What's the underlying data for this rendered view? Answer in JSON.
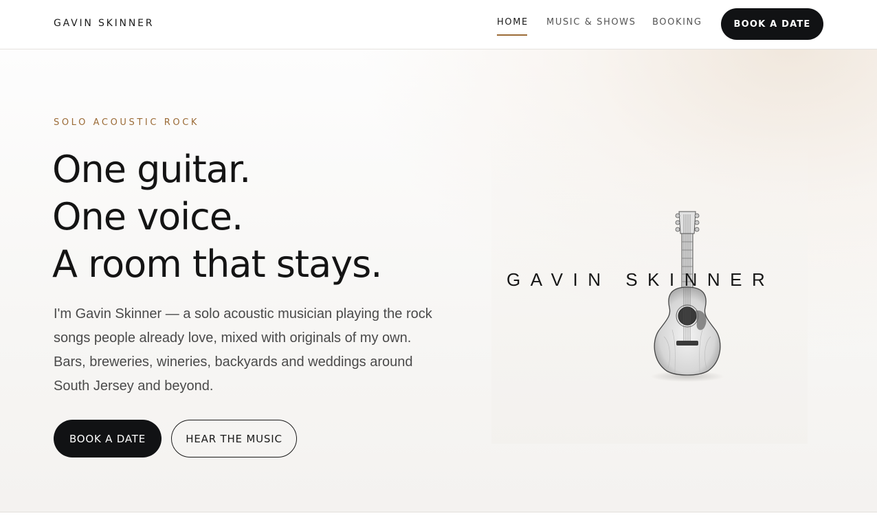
{
  "header": {
    "brand": "GAVIN SKINNER",
    "nav": {
      "home": "HOME",
      "music_shows": "MUSIC & SHOWS",
      "booking": "BOOKING",
      "cta": "BOOK A DATE"
    },
    "active_item": "HOME"
  },
  "hero": {
    "eyebrow": "SOLO ACOUSTIC ROCK",
    "headline": [
      "One guitar.",
      "One voice.",
      "A room that stays."
    ],
    "intro": "I'm Gavin Skinner — a solo acoustic musician playing the rock songs people already love, mixed with originals of my own. Bars, breweries, wineries, backyards and weddings around South Jersey and beyond.",
    "primary_button": "BOOK A DATE",
    "secondary_button": "HEAR THE MUSIC"
  },
  "artwork": {
    "logo_text": "GAVIN SKINNER",
    "icon": "acoustic-guitar-sketch"
  },
  "colors": {
    "accent": "#9b6b36",
    "button_dark": "#111214",
    "text": "#141414"
  }
}
